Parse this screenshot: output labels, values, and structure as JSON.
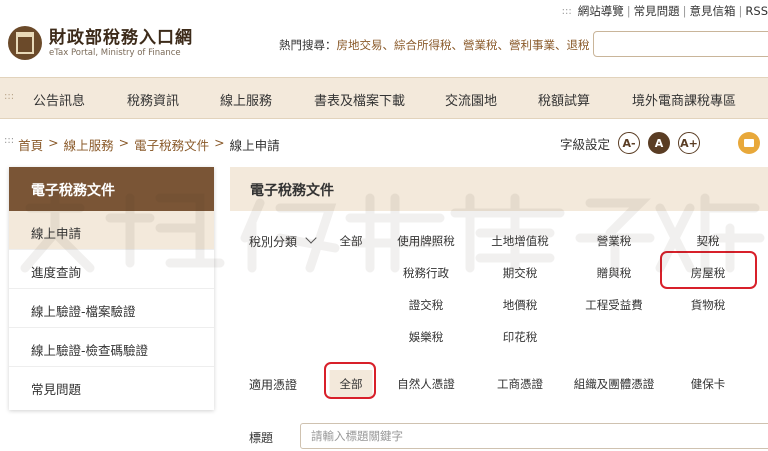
{
  "util_links": [
    "網站導覽",
    "常見問題",
    "意見信箱",
    "RSS"
  ],
  "logo": {
    "title": "財政部稅務入口網",
    "subtitle": "eTax Portal, Ministry of Finance"
  },
  "hot_search": {
    "label": "熱門搜尋：",
    "links": [
      "房地交易",
      "綜合所得稅",
      "營業稅",
      "營利事業",
      "退稅"
    ]
  },
  "nav": [
    "公告訊息",
    "稅務資訊",
    "線上服務",
    "書表及檔案下載",
    "交流園地",
    "稅額試算",
    "境外電商課稅專區"
  ],
  "breadcrumb": [
    "首頁",
    "線上服務",
    "電子稅務文件",
    "線上申請"
  ],
  "font_setting": {
    "label": "字級設定",
    "small": "A-",
    "medium": "A",
    "large": "A+"
  },
  "sidebar": {
    "title": "電子稅務文件",
    "items": [
      "線上申請",
      "進度查詢",
      "線上驗證-檔案驗證",
      "線上驗證-檢查碼驗證",
      "常見問題"
    ]
  },
  "content": {
    "title": "電子稅務文件",
    "tax_label": "稅別分類",
    "tax_options": [
      "全部",
      "使用牌照稅",
      "土地增值稅",
      "營業稅",
      "契稅",
      "稅務行政",
      "期交稅",
      "贈與稅",
      "房屋稅",
      "證交稅",
      "地價稅",
      "工程受益費",
      "貨物稅",
      "娛樂稅",
      "印花稅"
    ],
    "cert_label": "適用憑證",
    "cert_options": [
      "全部",
      "自然人憑證",
      "工商憑證",
      "組織及團體憑證",
      "健保卡"
    ],
    "title_label": "標題",
    "title_placeholder": "請輸入標題關鍵字"
  },
  "colors": {
    "brand": "#7a5536",
    "accent_bg": "#f3e9db",
    "link": "#8a5a2a",
    "highlight_ring": "#d8202a"
  }
}
